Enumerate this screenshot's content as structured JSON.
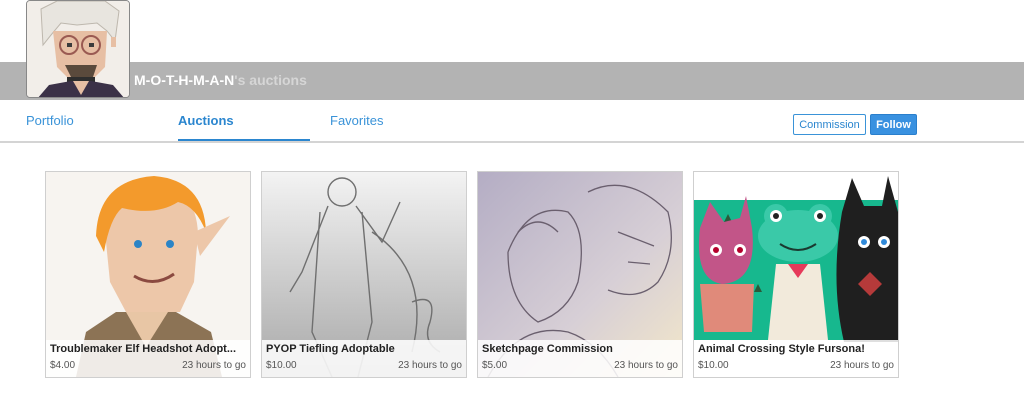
{
  "profile": {
    "username": "M-O-T-H-M-A-N",
    "title_suffix": "'s auctions",
    "avatar_icon": "pixel-art-avatar"
  },
  "tabs": [
    {
      "label": "Portfolio",
      "active": false
    },
    {
      "label": "Auctions",
      "active": true
    },
    {
      "label": "Favorites",
      "active": false
    }
  ],
  "actions": {
    "commission_label": "Commission",
    "follow_label": "Follow"
  },
  "colors": {
    "accent": "#2b86cf",
    "banner": "#b3b3b3",
    "follow_bg": "#3991e0"
  },
  "auctions": [
    {
      "title": "Troublemaker Elf Headshot Adopt...",
      "price": "$4.00",
      "time_left": "23 hours to go"
    },
    {
      "title": "PYOP Tiefling Adoptable",
      "price": "$10.00",
      "time_left": "23 hours to go"
    },
    {
      "title": "Sketchpage Commission",
      "price": "$5.00",
      "time_left": "23 hours to go"
    },
    {
      "title": "Animal Crossing Style Fursona!",
      "price": "$10.00",
      "time_left": "23 hours to go"
    }
  ]
}
